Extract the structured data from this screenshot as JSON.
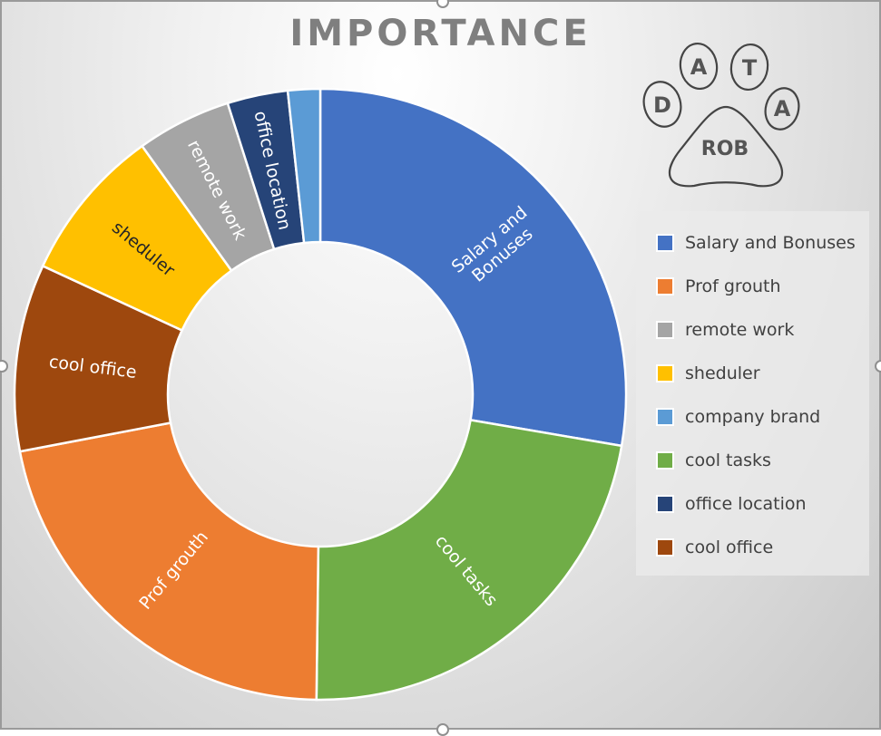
{
  "chart_data": {
    "type": "pie",
    "variant": "doughnut",
    "title": "IMPORTANCE",
    "start": "top",
    "direction": "clockwise",
    "legend_position": "right",
    "slices": [
      {
        "label": "Salary and Bonuses",
        "value": 27.7,
        "color": "#4472C4",
        "label_lines": [
          "Salary and",
          "Bonuses"
        ],
        "label_color": "#ffffff"
      },
      {
        "label": "cool tasks",
        "value": 22.5,
        "color": "#70AD47",
        "label_lines": [
          "cool tasks"
        ],
        "label_color": "#ffffff"
      },
      {
        "label": "Prof grouth",
        "value": 21.8,
        "color": "#ED7D31",
        "label_lines": [
          "Prof grouth"
        ],
        "label_color": "#ffffff"
      },
      {
        "label": "cool office",
        "value": 9.9,
        "color": "#9E480E",
        "label_lines": [
          "cool office"
        ],
        "label_color": "#ffffff"
      },
      {
        "label": "sheduler",
        "value": 8.2,
        "color": "#FFC000",
        "label_lines": [
          "sheduler"
        ],
        "label_color": "#262626"
      },
      {
        "label": "remote work",
        "value": 5.0,
        "color": "#A5A5A5",
        "label_lines": [
          "remote work"
        ],
        "label_color": "#ffffff"
      },
      {
        "label": "office location",
        "value": 3.2,
        "color": "#264478",
        "label_lines": [
          "office location"
        ],
        "label_color": "#ffffff"
      },
      {
        "label": "company brand",
        "value": 1.7,
        "color": "#5B9BD5",
        "label_lines": [],
        "label_color": "#ffffff"
      }
    ],
    "legend": [
      {
        "label": "Salary and Bonuses",
        "color": "#4472C4"
      },
      {
        "label": "Prof grouth",
        "color": "#ED7D31"
      },
      {
        "label": "remote work",
        "color": "#A5A5A5"
      },
      {
        "label": "sheduler",
        "color": "#FFC000"
      },
      {
        "label": "company brand",
        "color": "#5B9BD5"
      },
      {
        "label": "cool tasks",
        "color": "#70AD47"
      },
      {
        "label": "office location",
        "color": "#264478"
      },
      {
        "label": "cool office",
        "color": "#9E480E"
      }
    ]
  },
  "logo": {
    "toes": [
      "D",
      "A",
      "T",
      "A"
    ],
    "pad_text": "ROB"
  }
}
